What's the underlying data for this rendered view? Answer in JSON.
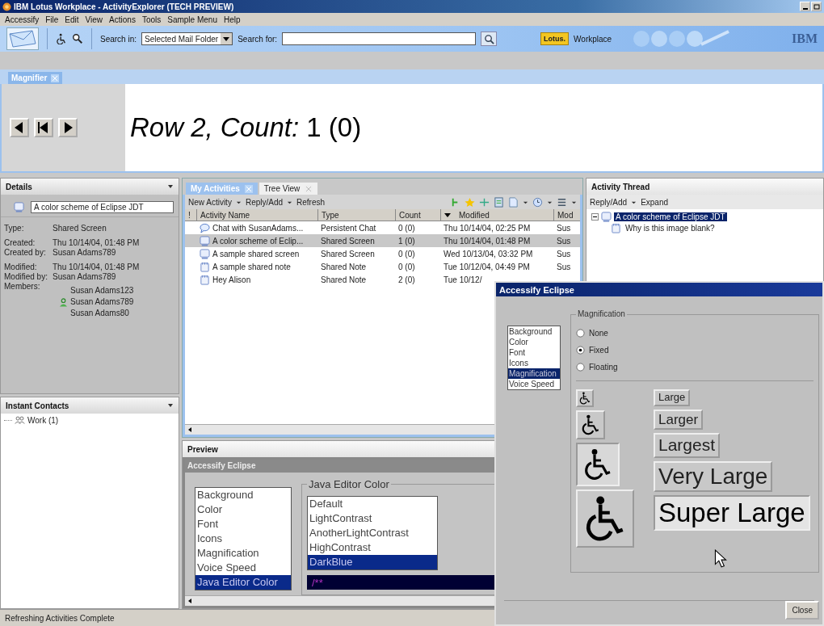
{
  "window": {
    "title": "IBM Lotus Workplace - ActivityExplorer (TECH PREVIEW)"
  },
  "menu": [
    "Accessify",
    "File",
    "Edit",
    "View",
    "Actions",
    "Tools",
    "Sample Menu",
    "Help"
  ],
  "toolbar": {
    "search_in_label": "Search in:",
    "search_in_value": "Selected Mail Folder",
    "search_for_label": "Search for:",
    "brand_badge": "Lotus.",
    "brand_name": "Workplace",
    "logo": "IBM"
  },
  "magnifier": {
    "tab": "Magnifier",
    "text": "*Row 2, Count:* 1 (0)"
  },
  "details": {
    "title": "Details",
    "name_value": "A color scheme of Eclipse JDT",
    "field_groups": [
      [
        {
          "label": "Type:",
          "value": "Shared Screen"
        }
      ],
      [
        {
          "label": "Created:",
          "value": "Thu 10/14/04, 01:48 PM"
        },
        {
          "label": "Created by:",
          "value": "Susan Adams789"
        }
      ],
      [
        {
          "label": "Modified:",
          "value": "Thu 10/14/04, 01:48 PM"
        },
        {
          "label": "Modified by:",
          "value": "Susan Adams789"
        }
      ]
    ],
    "members_label": "Members:",
    "members": [
      {
        "name": "Susan Adams123",
        "online": false
      },
      {
        "name": "Susan Adams789",
        "online": true
      },
      {
        "name": "Susan Adams80",
        "online": false
      }
    ]
  },
  "contacts": {
    "title": "Instant Contacts",
    "items": [
      {
        "label": "Work (1)"
      }
    ]
  },
  "activities": {
    "tabs": [
      {
        "label": "My Activities",
        "selected": true
      },
      {
        "label": "Tree View",
        "selected": false
      }
    ],
    "actions": [
      {
        "label": "New Activity",
        "dropdown": true
      },
      {
        "label": "Reply/Add",
        "dropdown": true
      },
      {
        "label": "Refresh",
        "dropdown": false
      }
    ],
    "columns": [
      "!",
      "Activity Name",
      "Type",
      "Count",
      "Modified",
      "Mod"
    ],
    "rows": [
      {
        "kind": "chat",
        "name": "Chat with SusanAdams...",
        "type": "Persistent Chat",
        "count": "0 (0)",
        "modified": "Thu 10/14/04, 02:25 PM",
        "mod": "Sus",
        "selected": false
      },
      {
        "kind": "screen",
        "name": "A color scheme of Eclip...",
        "type": "Shared Screen",
        "count": "1 (0)",
        "modified": "Thu 10/14/04, 01:48 PM",
        "mod": "Sus",
        "selected": true
      },
      {
        "kind": "screen",
        "name": "A sample shared screen",
        "type": "Shared Screen",
        "count": "0 (0)",
        "modified": "Wed 10/13/04, 03:32 PM",
        "mod": "Sus",
        "selected": false
      },
      {
        "kind": "note",
        "name": "A sample shared note",
        "type": "Shared Note",
        "count": "0 (0)",
        "modified": "Tue 10/12/04, 04:49 PM",
        "mod": "Sus",
        "selected": false
      },
      {
        "kind": "note",
        "name": "Hey Alison",
        "type": "Shared Note",
        "count": "2 (0)",
        "modified": "Tue 10/12/",
        "selected": false
      }
    ]
  },
  "preview": {
    "title": "Preview",
    "dialog_title": "Accessify Eclipse",
    "categories": [
      {
        "label": "Background",
        "selected": false
      },
      {
        "label": "Color",
        "selected": false
      },
      {
        "label": "Font",
        "selected": false
      },
      {
        "label": "Icons",
        "selected": false
      },
      {
        "label": "Magnification",
        "selected": false
      },
      {
        "label": "Voice Speed",
        "selected": false
      },
      {
        "label": "Java Editor Color",
        "selected": true
      }
    ],
    "group": "Java Editor Color",
    "schemes": [
      {
        "label": "Default",
        "selected": false
      },
      {
        "label": "LightContrast",
        "selected": false
      },
      {
        "label": "AnotherLightContrast",
        "selected": false
      },
      {
        "label": "HighContrast",
        "selected": false
      },
      {
        "label": "DarkBlue",
        "selected": true
      }
    ],
    "code": "/**"
  },
  "thread": {
    "title": "Activity Thread",
    "actions": [
      {
        "label": "Reply/Add",
        "dropdown": true
      },
      {
        "label": "Expand",
        "dropdown": false
      }
    ],
    "tree": [
      {
        "label": "A color scheme of Eclipse JDT",
        "selected": true,
        "expanded": true,
        "children": [
          {
            "label": "Why is this image blank?",
            "selected": false
          }
        ]
      }
    ]
  },
  "dialog": {
    "title": "Accessify Eclipse",
    "categories": [
      {
        "label": "Background",
        "selected": false
      },
      {
        "label": "Color",
        "selected": false
      },
      {
        "label": "Font",
        "selected": false
      },
      {
        "label": "Icons",
        "selected": false
      },
      {
        "label": "Magnification",
        "selected": true
      },
      {
        "label": "Voice Speed",
        "selected": false
      }
    ],
    "group": "Magnification",
    "options": [
      {
        "label": "None",
        "selected": false
      },
      {
        "label": "Fixed",
        "selected": true
      },
      {
        "label": "Floating",
        "selected": false
      }
    ],
    "icon_sizes": [
      {
        "selected": false
      },
      {
        "selected": false
      },
      {
        "selected": true
      },
      {
        "selected": false
      }
    ],
    "text_sizes": [
      {
        "label": "Large",
        "selected": false
      },
      {
        "label": "Larger",
        "selected": false
      },
      {
        "label": "Largest",
        "selected": false
      },
      {
        "label": "Very Large",
        "selected": false
      },
      {
        "label": "Super Large",
        "selected": true
      }
    ],
    "close": "Close"
  },
  "status_bar": "Refreshing Activities Complete"
}
